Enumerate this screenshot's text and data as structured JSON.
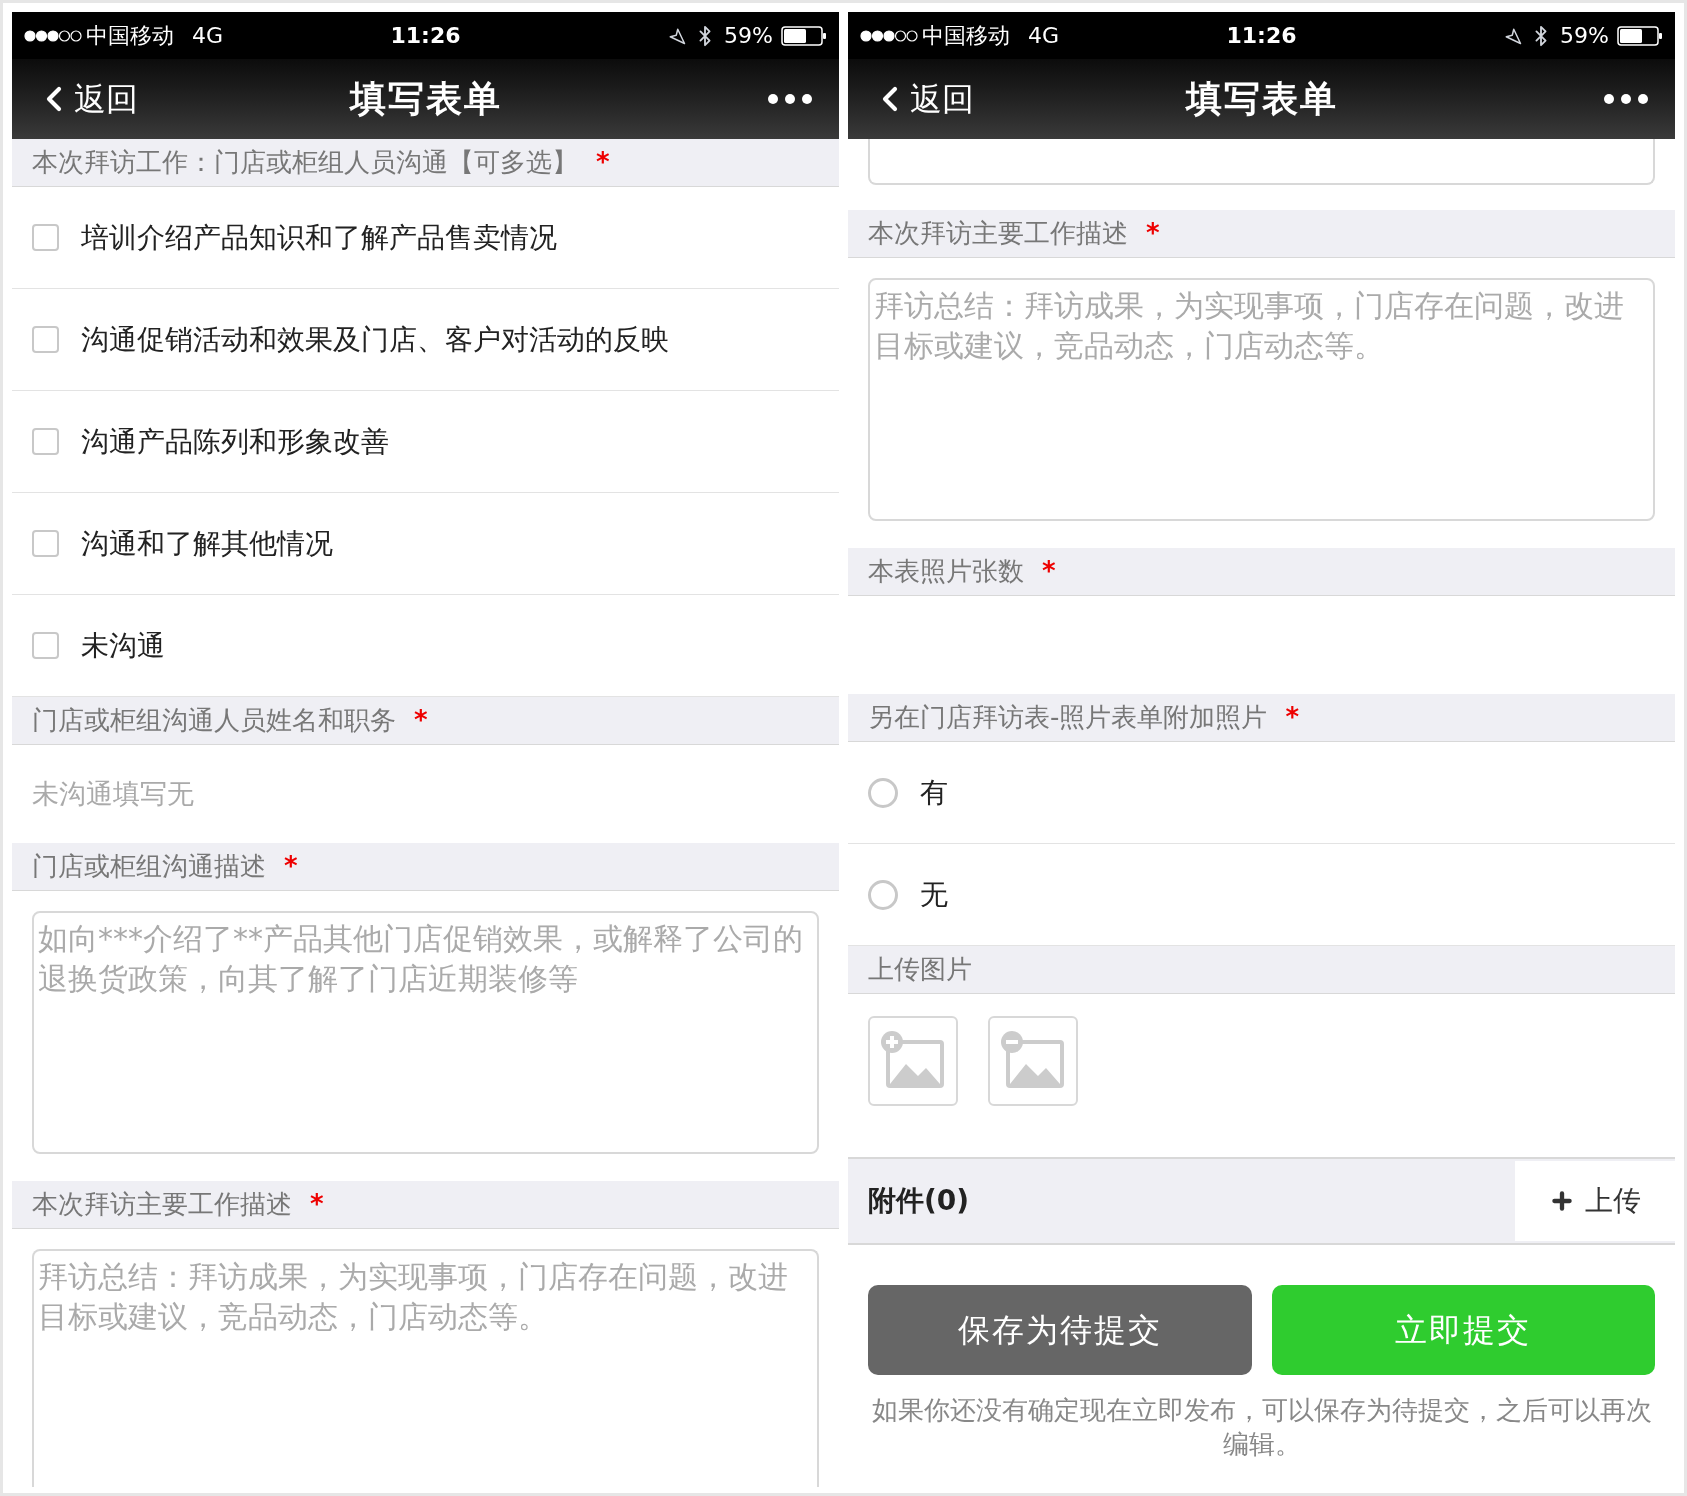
{
  "screens": [
    {
      "status_bar": {
        "carrier": "中国移动",
        "network": "4G",
        "time": "11:26",
        "battery": "59%"
      },
      "nav": {
        "back": "返回",
        "title": "填写表单"
      },
      "sections": [
        {
          "kind": "header",
          "label": "本次拜访工作：门店或柜组人员沟通【可多选】",
          "mark": "*"
        },
        {
          "kind": "checkbox",
          "label": "培训介绍产品知识和了解产品售卖情况",
          "checked": false
        },
        {
          "kind": "checkbox",
          "label": "沟通促销活动和效果及门店、客户对活动的反映",
          "checked": false
        },
        {
          "kind": "checkbox",
          "label": "沟通产品陈列和形象改善",
          "checked": false
        },
        {
          "kind": "checkbox",
          "label": "沟通和了解其他情况",
          "checked": false
        },
        {
          "kind": "checkbox",
          "label": "未沟通",
          "checked": false
        },
        {
          "kind": "header",
          "label": "门店或柜组沟通人员姓名和职务",
          "mark": "*"
        },
        {
          "kind": "input",
          "placeholder": "未沟通填写无"
        },
        {
          "kind": "header",
          "label": "门店或柜组沟通描述",
          "mark": "*"
        },
        {
          "kind": "textarea",
          "placeholder": "如向***介绍了**产品其他门店促销效果，或解释了公司的退换货政策，向其了解了门店近期装修等"
        },
        {
          "kind": "header",
          "label": "本次拜访主要工作描述",
          "mark": "*"
        },
        {
          "kind": "textarea_cut",
          "placeholder": "拜访总结：拜访成果，为实现事项，门店存在问题，改进目标或建议，竞品动态，门店动态等。"
        }
      ]
    },
    {
      "status_bar": {
        "carrier": "中国移动",
        "network": "4G",
        "time": "11:26",
        "battery": "59%"
      },
      "nav": {
        "back": "返回",
        "title": "填写表单"
      },
      "sections": [
        {
          "kind": "field_tail"
        },
        {
          "kind": "header",
          "label": "本次拜访主要工作描述",
          "mark": "*"
        },
        {
          "kind": "textarea",
          "placeholder": "拜访总结：拜访成果，为实现事项，门店存在问题，改进目标或建议，竞品动态，门店动态等。"
        },
        {
          "kind": "header",
          "label": "本表照片张数",
          "mark": "*"
        },
        {
          "kind": "blank_input"
        },
        {
          "kind": "header",
          "label": "另在门店拜访表-照片表单附加照片",
          "mark": "*"
        },
        {
          "kind": "radio",
          "label": "有",
          "selected": false
        },
        {
          "kind": "radio",
          "label": "无",
          "selected": false
        },
        {
          "kind": "header",
          "label": "上传图片"
        },
        {
          "kind": "image_buttons"
        },
        {
          "kind": "attachment",
          "label": "附件(0)",
          "action": "上传"
        },
        {
          "kind": "buttons",
          "items": [
            {
              "label": "保存为待提交"
            },
            {
              "label": "立即提交"
            }
          ]
        },
        {
          "kind": "note",
          "text": "如果你还没有确定现在立即发布，可以保存为待提交，之后可以再次编辑。"
        }
      ]
    }
  ]
}
